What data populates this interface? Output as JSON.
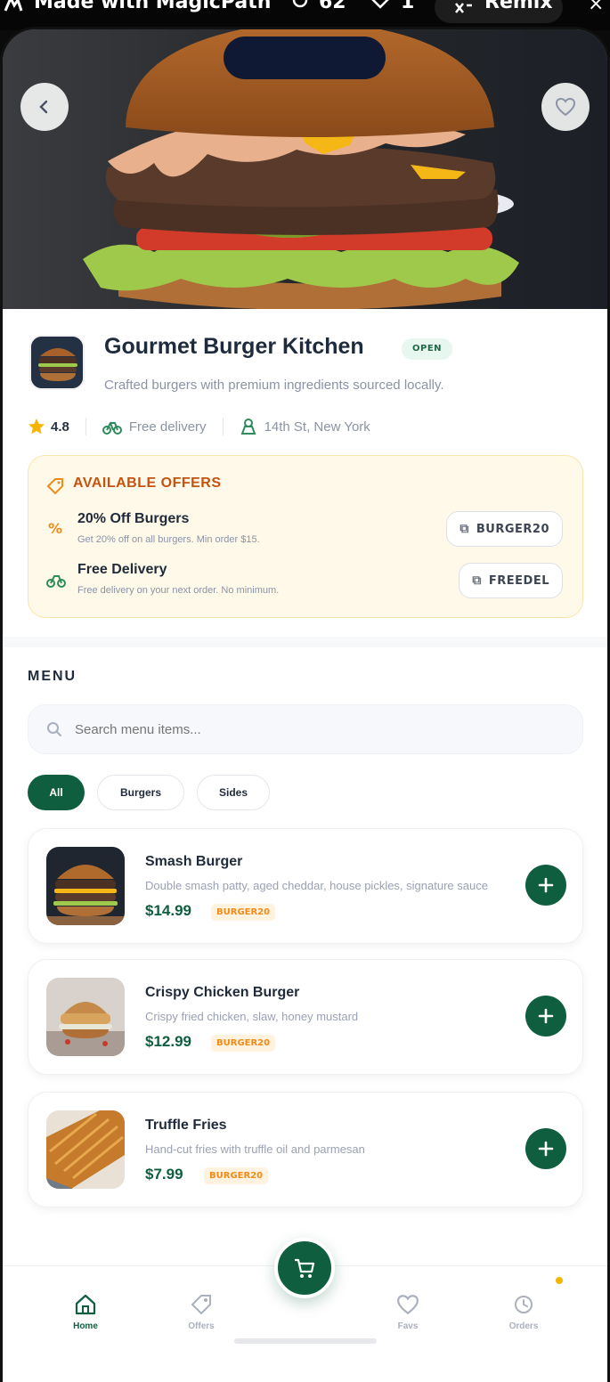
{
  "topbar": {
    "made_with": "Made with MagicPath",
    "views": "62",
    "likes": "1",
    "remix": "Remix"
  },
  "restaurant": {
    "name": "Gourmet Burger Kitchen",
    "status": "OPEN",
    "description": "Crafted burgers with premium ingredients sourced locally.",
    "rating": "4.8",
    "delivery": "Free delivery",
    "location": "14th St, New York"
  },
  "offers": {
    "heading": "AVAILABLE OFFERS",
    "items": [
      {
        "title": "20% Off Burgers",
        "description": "Get 20% off on all burgers. Min order $15.",
        "code": "BURGER20",
        "icon": "percent-icon"
      },
      {
        "title": "Free Delivery",
        "description": "Free delivery on your next order. No minimum.",
        "code": "FREEDEL",
        "icon": "bike-icon"
      }
    ]
  },
  "menu": {
    "heading": "MENU",
    "search_placeholder": "Search menu items...",
    "categories": [
      "All",
      "Burgers",
      "Sides"
    ],
    "active_category": "All",
    "items": [
      {
        "name": "Smash Burger",
        "description": "Double smash patty, aged cheddar, house pickles, signature sauce",
        "price": "$14.99",
        "promo": "BURGER20"
      },
      {
        "name": "Crispy Chicken Burger",
        "description": "Crispy fried chicken, slaw, honey mustard",
        "price": "$12.99",
        "promo": "BURGER20"
      },
      {
        "name": "Truffle Fries",
        "description": "Hand-cut fries with truffle oil and parmesan",
        "price": "$7.99",
        "promo": "BURGER20"
      }
    ]
  },
  "nav": {
    "items": [
      {
        "label": "Home",
        "icon": "home-icon",
        "active": true
      },
      {
        "label": "Offers",
        "icon": "tag-icon",
        "active": false
      },
      {
        "label": "Favs",
        "icon": "heart-icon",
        "active": false
      },
      {
        "label": "Orders",
        "icon": "history-icon",
        "active": false
      }
    ],
    "cart_icon": "cart-icon"
  },
  "colors": {
    "primary": "#0f5e3f",
    "accent_orange": "#c5520e",
    "star": "#f5b400",
    "offers_bg": "#fef9e8"
  }
}
